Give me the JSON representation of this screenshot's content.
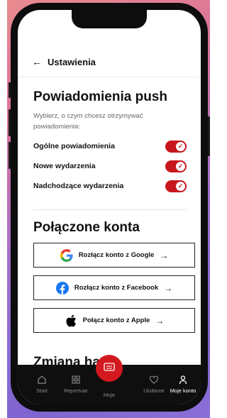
{
  "header": {
    "title": "Ustawienia",
    "back_icon": "arrow-left-icon"
  },
  "push": {
    "title": "Powiadomienia push",
    "description": "Wybierz, o czym chcesz otrzymywać powiadomienia:",
    "toggles": [
      {
        "label": "Ogólne powiadomienia",
        "on": true
      },
      {
        "label": "Nowe wydarzenia",
        "on": true
      },
      {
        "label": "Nadchodzące wydarzenia",
        "on": true
      }
    ]
  },
  "accounts": {
    "title": "Połączone konta",
    "buttons": [
      {
        "label": "Rozłącz konto z Google",
        "icon": "google-icon"
      },
      {
        "label": "Rozłącz konto z Facebook",
        "icon": "facebook-icon"
      },
      {
        "label": "Połącz konto z Apple",
        "icon": "apple-icon"
      }
    ]
  },
  "password": {
    "title": "Zmiana hasła"
  },
  "tabbar": {
    "tabs": [
      {
        "label": "Start",
        "icon": "home-icon"
      },
      {
        "label": "Repertuar",
        "icon": "grid-icon"
      },
      {
        "label": "Moje",
        "icon": "ticket-icon"
      },
      {
        "label": "Ulubione",
        "icon": "heart-icon"
      },
      {
        "label": "Moje konto",
        "icon": "user-icon",
        "active": true
      }
    ]
  },
  "colors": {
    "accent": "#c8161d",
    "tabbar": "#0f0f0f",
    "facebook": "#1877f2"
  }
}
